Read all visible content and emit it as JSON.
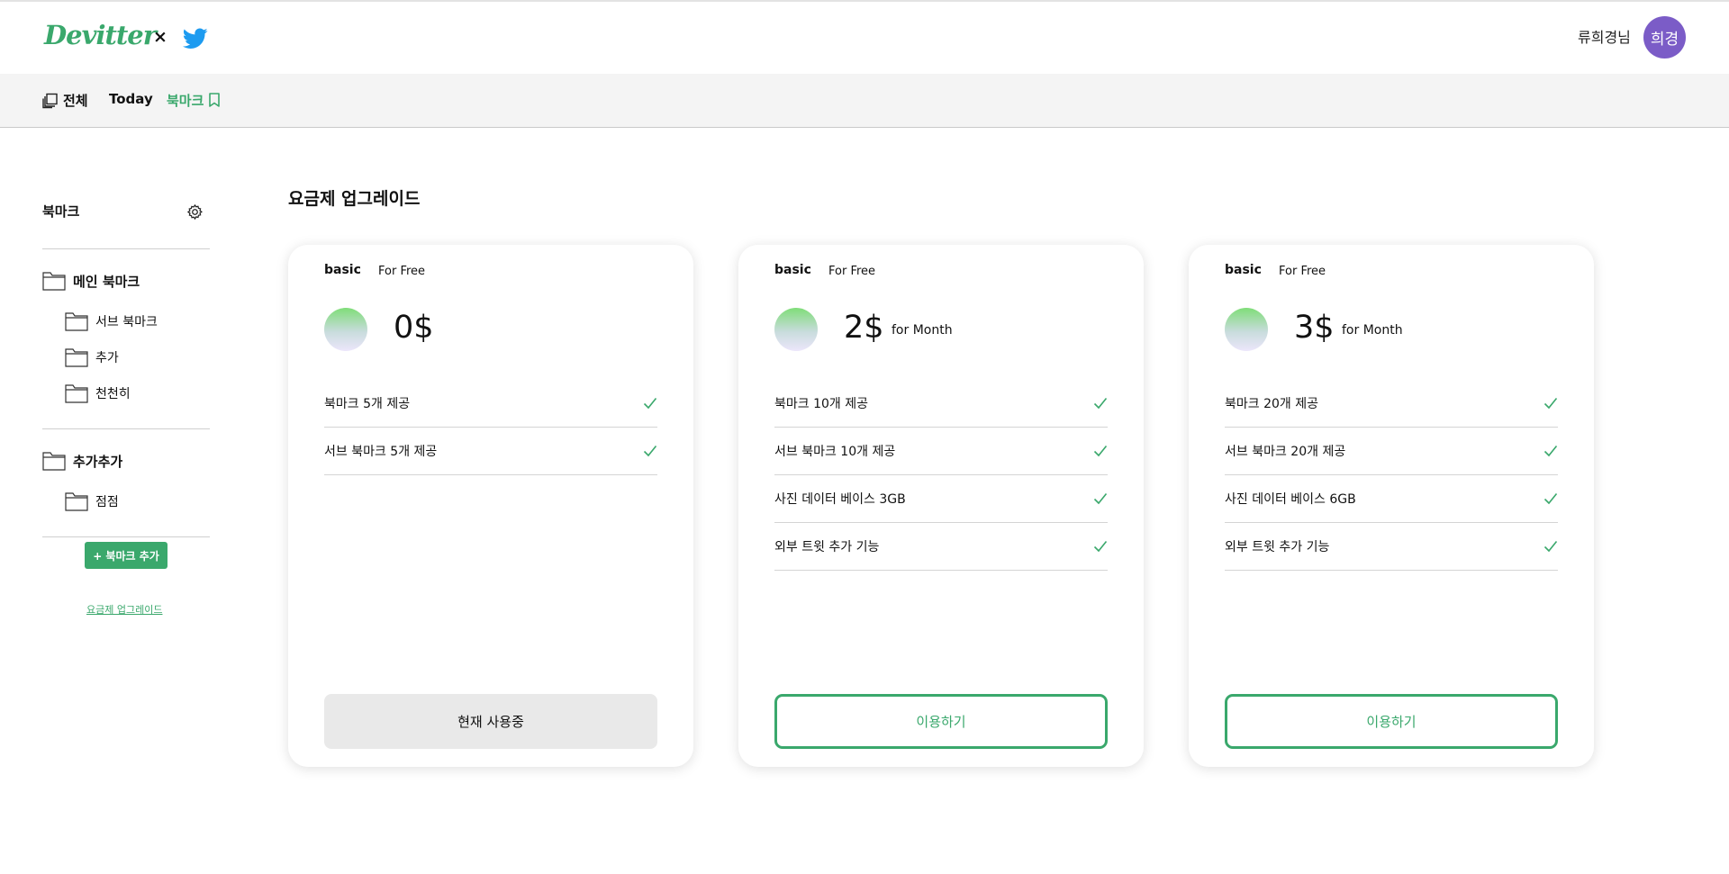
{
  "header": {
    "logo": "Devitter",
    "times": "×",
    "username": "류희경님",
    "avatar_text": "희경",
    "brand_color": "#3aa86c",
    "avatar_color": "#7b5cc7"
  },
  "nav": {
    "items": [
      {
        "label": "전체",
        "icon": "stack-icon"
      },
      {
        "label": "Today"
      },
      {
        "label": "북마크",
        "icon": "bookmark-icon",
        "active": true
      }
    ]
  },
  "sidebar": {
    "title": "북마크",
    "groups": [
      {
        "label": "메인 북마크",
        "children": [
          "서브 북마크",
          "추가",
          "천천히"
        ]
      },
      {
        "label": "추가추가",
        "children": [
          "점점"
        ]
      }
    ],
    "add_button": "+ 북마크 추가",
    "upgrade_link": "요금제 업그레이드"
  },
  "main": {
    "title": "요금제 업그레이드",
    "plans": [
      {
        "name": "basic",
        "subtitle": "For Free",
        "price": "0$",
        "period": "",
        "features": [
          "북마크 5개 제공",
          "서브 북마크 5개 제공"
        ],
        "button": "현재 사용중"
      },
      {
        "name": "basic",
        "subtitle": "For Free",
        "price": "2$",
        "period": "for Month",
        "features": [
          "북마크 10개 제공",
          "서브 북마크 10개 제공",
          "사진 데이터 베이스 3GB",
          "외부 트윗 추가 기능"
        ],
        "button": "이용하기"
      },
      {
        "name": "basic",
        "subtitle": "For Free",
        "price": "3$",
        "period": "for Month",
        "features": [
          "북마크 20개 제공",
          "서브 북마크 20개 제공",
          "사진 데이터 베이스 6GB",
          "외부 트윗 추가 기능"
        ],
        "button": "이용하기"
      }
    ]
  }
}
